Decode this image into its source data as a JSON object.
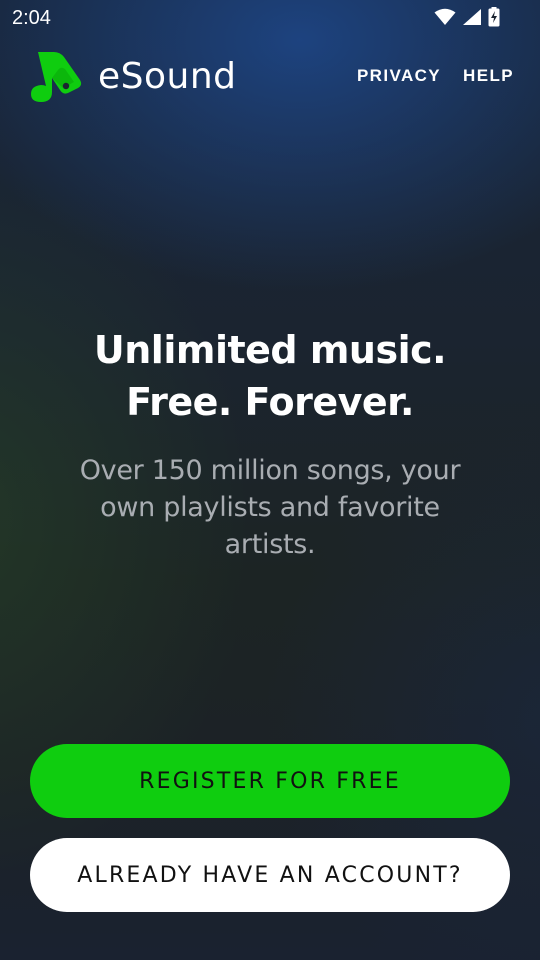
{
  "status_bar": {
    "time": "2:04",
    "icons": [
      "wifi-icon",
      "cellular-signal-icon",
      "battery-charging-icon"
    ]
  },
  "header": {
    "brand": "eSound",
    "nav": {
      "privacy_label": "PRIVACY",
      "help_label": "HELP"
    }
  },
  "hero": {
    "title_line1": "Unlimited music.",
    "title_line2": "Free. Forever.",
    "subtitle": "Over 150 million songs, your own playlists and favorite artists."
  },
  "actions": {
    "register_label": "REGISTER FOR FREE",
    "login_label": "ALREADY HAVE AN ACCOUNT?"
  },
  "colors": {
    "brand_green": "#0fcd0f",
    "secondary_button": "#ffffff",
    "subtitle_text": "#a9adb2"
  }
}
